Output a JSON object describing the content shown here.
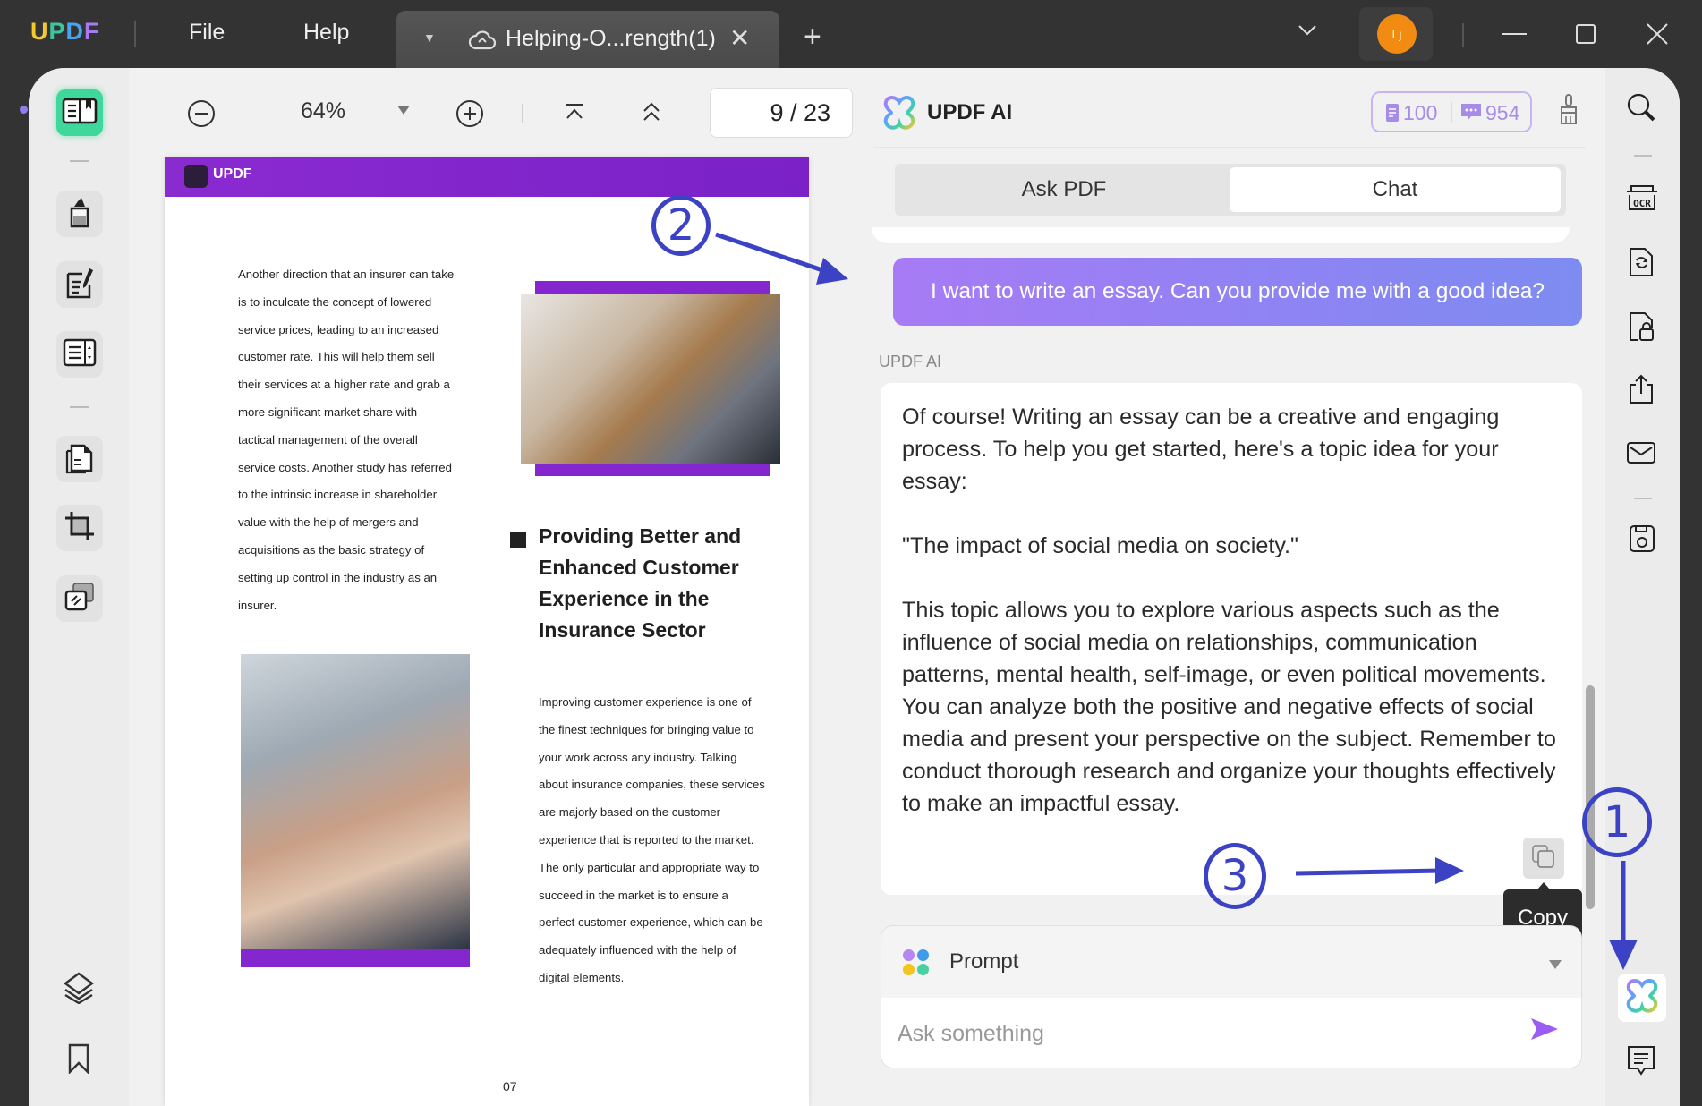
{
  "titlebar": {
    "logo_letters": [
      "U",
      "P",
      "D",
      "F"
    ],
    "menu": [
      "File",
      "Help"
    ],
    "tab_title": "Helping-O...rength(1)",
    "avatar_initials": "Lj"
  },
  "toolbar": {
    "zoom": "64%",
    "page_current": "9",
    "page_total": "23",
    "page_display": "9  /  23"
  },
  "pdf": {
    "brand": "UPDF",
    "left_column": [
      "Another direction that an insurer can take",
      "is to inculcate the concept of lowered",
      "service prices, leading to an increased",
      "customer rate. This will help them sell",
      "their services at a higher rate and grab a",
      "more significant market share with",
      "tactical management of the overall",
      "service costs. Another study has referred",
      "to the intrinsic increase in shareholder",
      "value with the help of mergers and",
      "acquisitions as the basic strategy of",
      "setting up control in the industry as an",
      "insurer."
    ],
    "heading": "Providing Better and Enhanced Customer Experience in the Insurance Sector",
    "right_column": [
      "Improving customer experience is one of",
      "the finest techniques for bringing value to",
      "your work across any industry. Talking",
      "about insurance companies, these services",
      "are majorly based on the customer",
      "experience that is reported to the market.",
      "The only particular and appropriate way to",
      "succeed in the market is to ensure a",
      "perfect customer experience, which can be",
      "adequately influenced with the help of",
      "digital elements."
    ],
    "page_number": "07"
  },
  "ai_panel": {
    "title": "UPDF AI",
    "quota_pdf": "100",
    "quota_chat": "954",
    "tabs": [
      {
        "label": "Ask PDF",
        "active": false
      },
      {
        "label": "Chat",
        "active": true
      }
    ],
    "user_message": "I want to write an essay. Can you provide me with a good idea?",
    "assistant_label": "UPDF AI",
    "response_paragraphs": [
      "Of course! Writing an essay can be a creative and engaging process. To help you get started, here's a topic idea for your essay:",
      "\"The impact of social media on society.\"",
      "This topic allows you to explore various aspects such as the influence of social media on relationships, communication patterns, mental health, self-image, or even political movements. You can analyze both the positive and negative effects of social media and present your perspective on the subject. Remember to conduct thorough research and organize your thoughts effectively to make an impactful essay."
    ],
    "copy_tooltip": "Copy",
    "prompt_label": "Prompt",
    "input_placeholder": "Ask something",
    "input_value": ""
  },
  "annotations": {
    "step1": "1",
    "step2": "2",
    "step3": "3"
  },
  "colors": {
    "accent_purple": "#8b5cf6",
    "annotation_blue": "#3b43c4",
    "active_green": "#3ed79c",
    "avatar_orange": "#f18b11"
  }
}
